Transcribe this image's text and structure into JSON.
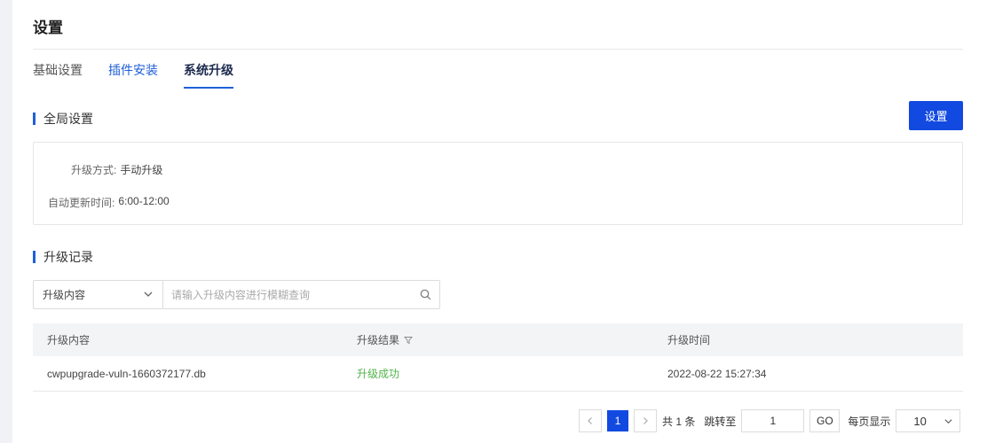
{
  "page": {
    "title": "设置"
  },
  "tabs": [
    {
      "label": "基础设置"
    },
    {
      "label": "插件安装"
    },
    {
      "label": "系统升级"
    }
  ],
  "global_settings": {
    "section_title": "全局设置",
    "settings_button": "设置",
    "upgrade_mode_label": "升级方式:",
    "upgrade_mode_value": "手动升级",
    "auto_update_label": "自动更新时间:",
    "auto_update_value": "6:00-12:00"
  },
  "records": {
    "section_title": "升级记录",
    "filter_select": "升级内容",
    "search_placeholder": "请输入升级内容进行模糊查询",
    "columns": [
      "升级内容",
      "升级结果",
      "升级时间"
    ],
    "rows": [
      {
        "content": "cwpupgrade-vuln-1660372177.db",
        "result": "升级成功",
        "time": "2022-08-22 15:27:34"
      }
    ]
  },
  "pagination": {
    "current_page": "1",
    "total": "共 1 条",
    "jump_label": "跳转至",
    "jump_value": "1",
    "go_label": "GO",
    "page_size_label": "每页显示",
    "page_size": "10"
  },
  "colors": {
    "accent": "#1f5fd8",
    "button": "#1249e0",
    "success": "#52b34a"
  },
  "icons": {
    "search": "search-icon",
    "chevron": "chevron-down-icon",
    "filter": "filter-icon",
    "prev": "chevron-left-icon",
    "next": "chevron-right-icon"
  }
}
